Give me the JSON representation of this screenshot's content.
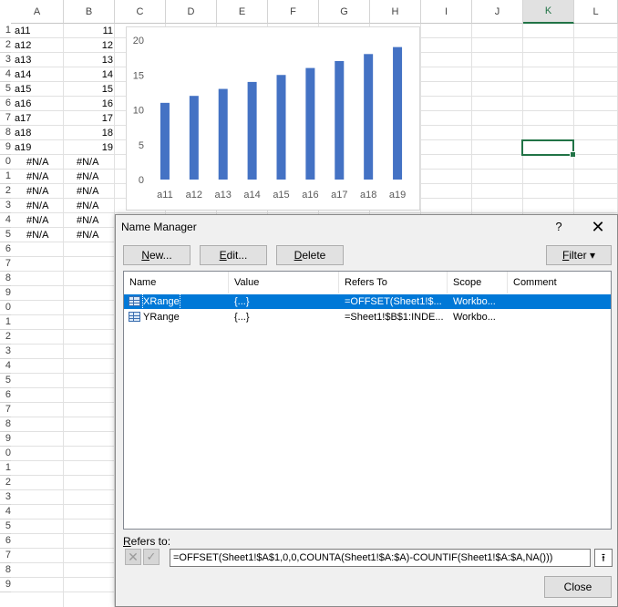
{
  "columns": [
    "A",
    "B",
    "C",
    "D",
    "E",
    "F",
    "G",
    "H",
    "I",
    "J",
    "K",
    "L"
  ],
  "selected_column": "K",
  "rows": [
    {
      "num": "1",
      "a": "a11",
      "b": "11"
    },
    {
      "num": "2",
      "a": "a12",
      "b": "12"
    },
    {
      "num": "3",
      "a": "a13",
      "b": "13"
    },
    {
      "num": "4",
      "a": "a14",
      "b": "14"
    },
    {
      "num": "5",
      "a": "a15",
      "b": "15"
    },
    {
      "num": "6",
      "a": "a16",
      "b": "16"
    },
    {
      "num": "7",
      "a": "a17",
      "b": "17"
    },
    {
      "num": "8",
      "a": "a18",
      "b": "18"
    },
    {
      "num": "9",
      "a": "a19",
      "b": "19"
    },
    {
      "num": "0",
      "a": "#N/A",
      "b": "#N/A"
    },
    {
      "num": "1",
      "a": "#N/A",
      "b": "#N/A"
    },
    {
      "num": "2",
      "a": "#N/A",
      "b": "#N/A"
    },
    {
      "num": "3",
      "a": "#N/A",
      "b": "#N/A"
    },
    {
      "num": "4",
      "a": "#N/A",
      "b": "#N/A"
    },
    {
      "num": "5",
      "a": "#N/A",
      "b": "#N/A"
    },
    {
      "num": "6",
      "a": "",
      "b": ""
    },
    {
      "num": "7",
      "a": "",
      "b": ""
    },
    {
      "num": "8",
      "a": "",
      "b": ""
    },
    {
      "num": "9",
      "a": "",
      "b": ""
    },
    {
      "num": "0",
      "a": "",
      "b": ""
    },
    {
      "num": "1",
      "a": "",
      "b": ""
    },
    {
      "num": "2",
      "a": "",
      "b": ""
    },
    {
      "num": "3",
      "a": "",
      "b": ""
    },
    {
      "num": "4",
      "a": "",
      "b": ""
    },
    {
      "num": "5",
      "a": "",
      "b": ""
    },
    {
      "num": "6",
      "a": "",
      "b": ""
    },
    {
      "num": "7",
      "a": "",
      "b": ""
    },
    {
      "num": "8",
      "a": "",
      "b": ""
    },
    {
      "num": "9",
      "a": "",
      "b": ""
    },
    {
      "num": "0",
      "a": "",
      "b": ""
    },
    {
      "num": "1",
      "a": "",
      "b": ""
    },
    {
      "num": "2",
      "a": "",
      "b": ""
    },
    {
      "num": "3",
      "a": "",
      "b": ""
    },
    {
      "num": "4",
      "a": "",
      "b": ""
    },
    {
      "num": "5",
      "a": "",
      "b": ""
    },
    {
      "num": "6",
      "a": "",
      "b": ""
    },
    {
      "num": "7",
      "a": "",
      "b": ""
    },
    {
      "num": "8",
      "a": "",
      "b": ""
    },
    {
      "num": "9",
      "a": "",
      "b": ""
    }
  ],
  "chart_data": {
    "type": "bar",
    "categories": [
      "a11",
      "a12",
      "a13",
      "a14",
      "a15",
      "a16",
      "a17",
      "a18",
      "a19"
    ],
    "values": [
      11,
      12,
      13,
      14,
      15,
      16,
      17,
      18,
      19
    ],
    "ylim": [
      0,
      20
    ],
    "yticks": [
      "0",
      "5",
      "10",
      "15",
      "20"
    ],
    "bar_color": "#4472c4",
    "grid": false,
    "title": "",
    "xlabel": "",
    "ylabel": ""
  },
  "dialog": {
    "title": "Name Manager",
    "help": "?",
    "close_glyph": "✕",
    "buttons": {
      "new_u": "N",
      "new_rest": "ew...",
      "edit_u": "E",
      "edit_rest": "dit...",
      "delete_u": "D",
      "delete_rest": "elete",
      "filter_u": "F",
      "filter_rest": "ilter",
      "filter_arrow": "▾",
      "close": "Close"
    },
    "columns": [
      "Name",
      "Value",
      "Refers To",
      "Scope",
      "Comment"
    ],
    "names": [
      {
        "name": "XRange",
        "value": "{...}",
        "refers_to": "=OFFSET(Sheet1!$...",
        "scope": "Workbo...",
        "comment": "",
        "selected": true
      },
      {
        "name": "YRange",
        "value": "{...}",
        "refers_to": "=Sheet1!$B$1:INDE...",
        "scope": "Workbo...",
        "comment": "",
        "selected": false
      }
    ],
    "refers_label_u": "R",
    "refers_label_rest": "efers to:",
    "refers_value": "=OFFSET(Sheet1!$A$1,0,0,COUNTA(Sheet1!$A:$A)-COUNTIF(Sheet1!$A:$A,NA()))",
    "cancel_glyph": "✕",
    "ok_glyph": "✓",
    "collapse_glyph": "⭱"
  }
}
